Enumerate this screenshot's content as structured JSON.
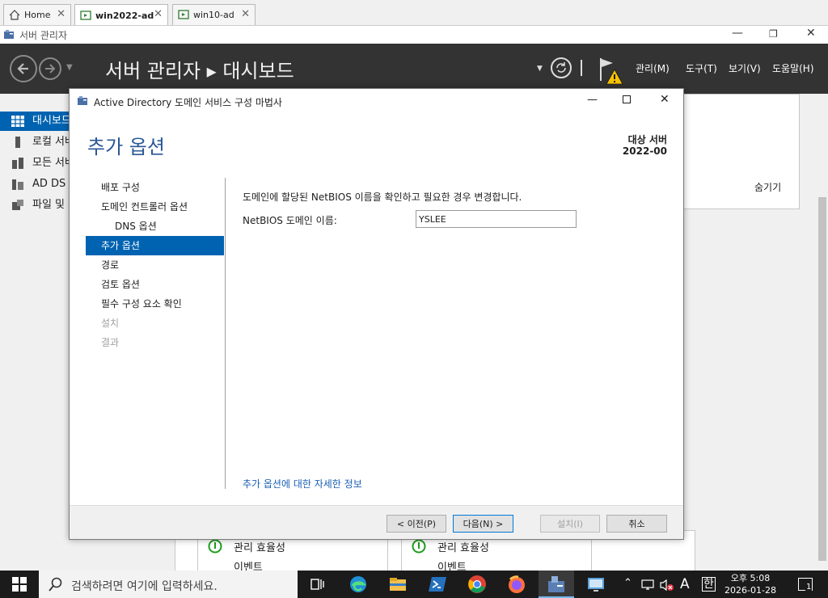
{
  "vm_tabs": [
    {
      "label": "Home"
    },
    {
      "label": "win2022-ad"
    },
    {
      "label": "win10-ad"
    }
  ],
  "server_manager": {
    "window_title": "서버 관리자",
    "header_title": "서버 관리자 ▸ 대시보드",
    "menus": [
      "관리(M)",
      "도구(T)",
      "보기(V)",
      "도움말(H)"
    ],
    "sidebar": [
      {
        "label": "대시보드"
      },
      {
        "label": "로컬 서버"
      },
      {
        "label": "모든 서버"
      },
      {
        "label": "AD DS"
      },
      {
        "label": "파일 및 저장소 서비스"
      }
    ],
    "hide_link": "숨기기",
    "tiles": [
      {
        "line1": "관리 효율성",
        "line2": "이벤트"
      },
      {
        "line1": "관리 효율성",
        "line2": "이벤트"
      }
    ]
  },
  "wizard": {
    "title": "Active Directory 도메인 서비스 구성 마법사",
    "heading": "추가 옵션",
    "target_label": "대상 서버",
    "target_value": "2022-00",
    "nav": [
      {
        "label": "배포 구성",
        "state": "normal"
      },
      {
        "label": "도메인 컨트롤러 옵션",
        "state": "normal"
      },
      {
        "label": "DNS 옵션",
        "state": "sub"
      },
      {
        "label": "추가 옵션",
        "state": "selected"
      },
      {
        "label": "경로",
        "state": "normal"
      },
      {
        "label": "검토 옵션",
        "state": "normal"
      },
      {
        "label": "필수 구성 요소 확인",
        "state": "normal"
      },
      {
        "label": "설치",
        "state": "disabled"
      },
      {
        "label": "결과",
        "state": "disabled"
      }
    ],
    "description": "도메인에 할당된 NetBIOS 이름을 확인하고 필요한 경우 변경합니다.",
    "netbios_label": "NetBIOS 도메인 이름:",
    "netbios_value": "YSLEE",
    "more_info_link": "추가 옵션에 대한 자세한 정보",
    "buttons": {
      "prev": "< 이전(P)",
      "next": "다음(N) >",
      "install": "설치(I)",
      "cancel": "취소"
    }
  },
  "taskbar": {
    "search_placeholder": "검색하려면 여기에 입력하세요.",
    "ime": "A",
    "ime2": "한",
    "time": "오후 5:08",
    "date": "2026-01-28",
    "notification_count": "1"
  },
  "colors": {
    "accent": "#0063b1",
    "header_bg": "#333333",
    "heading_blue": "#2b5797",
    "taskbar_bg": "#1b1b1b"
  }
}
